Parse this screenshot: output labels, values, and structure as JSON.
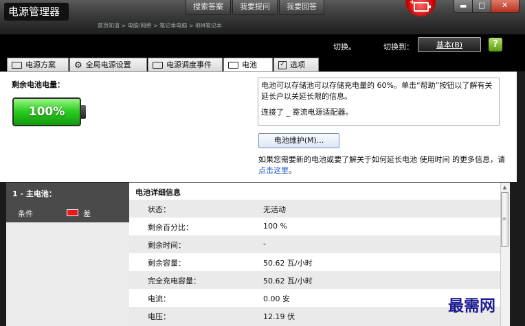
{
  "window": {
    "title": "电源管理器"
  },
  "top_buttons": [
    "搜索答案",
    "我要提问",
    "我要回答"
  ],
  "breadcrumb": "首页知道 > 电脑/网络 > 笔记本电脑 > IBM笔记本",
  "toolbar": {
    "switch_label": "切换。",
    "switch_to_label": "切换到：",
    "basic_button": "基本(B)"
  },
  "tabs": [
    {
      "label": "电源方案",
      "icon": "battery-rect-icon"
    },
    {
      "label": "全局电源设置",
      "icon": "gear-icon"
    },
    {
      "label": "电源调度事件",
      "icon": "schedule-icon"
    },
    {
      "label": "电池",
      "icon": "battery-rect-icon",
      "active": true
    },
    {
      "label": "选项",
      "icon": "checkbox-icon"
    }
  ],
  "battery": {
    "remaining_label": "剩余电池电量：",
    "percent_text": "100%",
    "level": 1.0
  },
  "info_box": {
    "line1": "电池可以存储池可以存储充电量的 60%。单击“帮助”按钮以了解有关延长户以关延长限的信息。",
    "line2": "连接了  _ 寄流电源适配器。"
  },
  "maintenance_button": "电池维护(M)...",
  "extend_text": {
    "before": "如果您需要新的电池或要了解关于如何延长电池 使用时间 的更多信息，请 ",
    "link": "点击这里",
    "after": "。"
  },
  "left_panel": {
    "title": "1 - 主电池：",
    "condition_label": "条件",
    "condition_value": "差"
  },
  "details": {
    "title": "电池详细信息",
    "rows": [
      {
        "label": "状态：",
        "value": "无活动"
      },
      {
        "label": "剩余百分比：",
        "value": "100 %"
      },
      {
        "label": "剩余时间：",
        "value": "-"
      },
      {
        "label": "剩余容量：",
        "value": "50.62 瓦/小时"
      },
      {
        "label": "完全充电容量：",
        "value": "50.62 瓦/小时"
      },
      {
        "label": "电流：",
        "value": "0.00 安"
      },
      {
        "label": "电压：",
        "value": "12.19 伏"
      }
    ]
  },
  "watermark": "最需网",
  "colors": {
    "battery_green": "#2fcf24",
    "condition_red": "#e31b1b",
    "link_blue": "#1a52c4"
  }
}
